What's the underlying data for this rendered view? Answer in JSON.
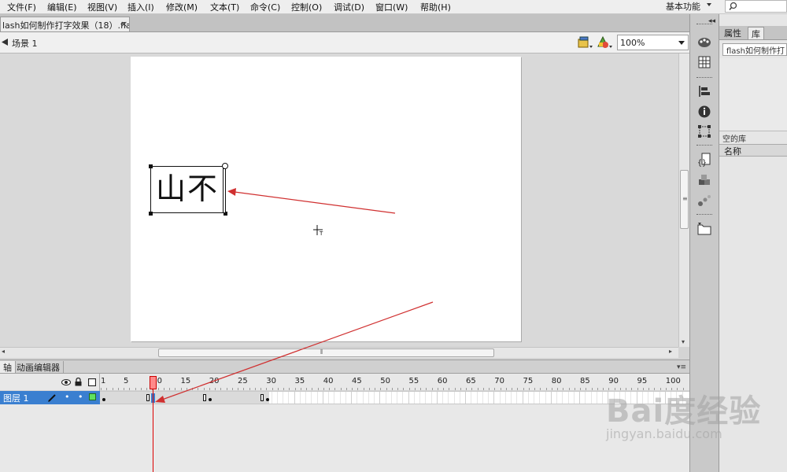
{
  "menu": {
    "items": [
      "文件(F)",
      "编辑(E)",
      "视图(V)",
      "插入(I)",
      "修改(M)",
      "文本(T)",
      "命令(C)",
      "控制(O)",
      "调试(D)",
      "窗口(W)",
      "帮助(H)"
    ],
    "workspace": "基本功能",
    "search_icon": "search-icon"
  },
  "document": {
    "tab_title": "lash如何制作打字效果（18）.fla*",
    "close": "×",
    "scene": "场景 1",
    "zoom": "100%"
  },
  "stage": {
    "text": "山不"
  },
  "timeline": {
    "tab_timeline": "轴",
    "tab_motion": "动画编辑器",
    "layer_name": "图层 1",
    "ruler": [
      "1",
      "5",
      "10",
      "15",
      "20",
      "25",
      "30",
      "35",
      "40",
      "45",
      "50",
      "55",
      "60",
      "65",
      "70",
      "75",
      "80",
      "85",
      "90",
      "95",
      "100"
    ],
    "current_frame": 10
  },
  "panels": {
    "tab_properties": "属性",
    "tab_library": "库",
    "library_doc": "flash如何制作打",
    "empty_library": "空的库",
    "name_column": "名称"
  },
  "watermark": {
    "logo": "Bai度经验",
    "url": "jingyan.baidu.com"
  },
  "colors": {
    "selected_layer": "#3a7fd0",
    "playhead": "#dd0000"
  }
}
